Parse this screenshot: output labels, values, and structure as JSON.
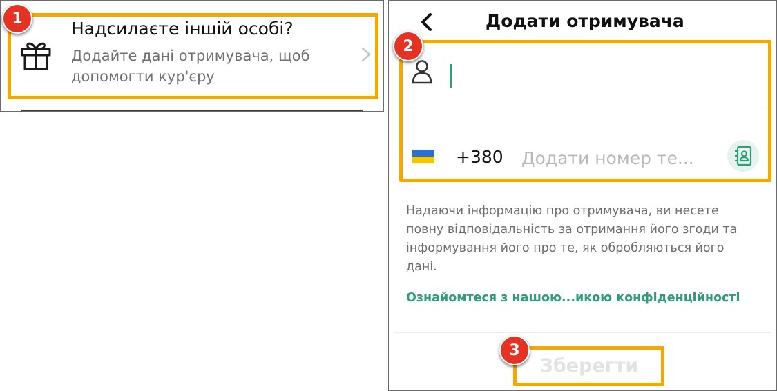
{
  "left_panel": {
    "badge": "1",
    "title": "Надсилаєте іншій особі?",
    "subtitle_line1": "Додайте дані отримувача, щоб",
    "subtitle_line2": "допомогти кур'єру",
    "icons": [
      "gift-icon",
      "chevron-right-icon"
    ]
  },
  "right_panel": {
    "title": "Додати отримувача",
    "badges": [
      "2",
      "3"
    ],
    "name_field": {
      "value": "",
      "icon": "person-icon"
    },
    "phone_field": {
      "flag": "ukraine-flag-icon",
      "country_code": "+380",
      "placeholder": "Додати номер те...",
      "value": ""
    },
    "contacts_icon": "contacts-book-icon",
    "disclaimer": "Надаючи інформацію про отримувача, ви несете повну відповідальність за отримання його згоди та інформування його про те, як обробляються його дані.",
    "privacy_link": "Ознайомтеся з нашою...икою конфіденційності",
    "save_label": "Зберегти"
  },
  "colors": {
    "highlight": "#f5a800",
    "badge": "#e53222",
    "accent_green": "#2f9e78",
    "muted_text": "#6e6e6e"
  }
}
